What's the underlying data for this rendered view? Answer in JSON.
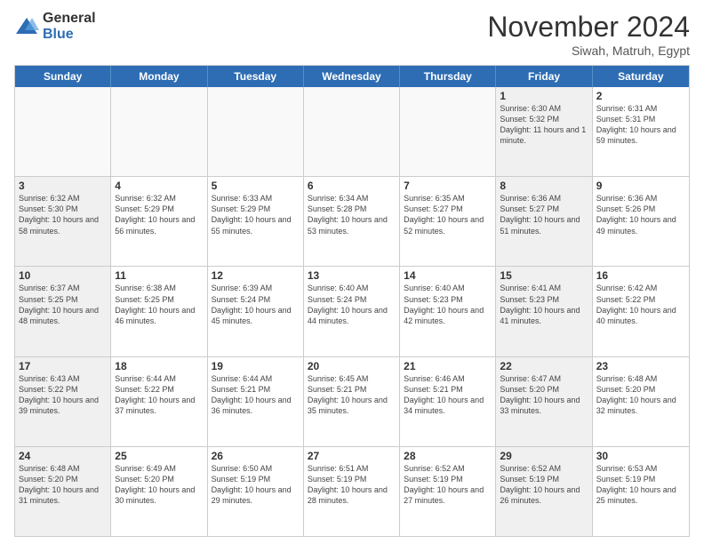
{
  "header": {
    "logo_general": "General",
    "logo_blue": "Blue",
    "month_title": "November 2024",
    "subtitle": "Siwah, Matruh, Egypt"
  },
  "days_of_week": [
    "Sunday",
    "Monday",
    "Tuesday",
    "Wednesday",
    "Thursday",
    "Friday",
    "Saturday"
  ],
  "weeks": [
    [
      {
        "day": "",
        "info": "",
        "empty": true
      },
      {
        "day": "",
        "info": "",
        "empty": true
      },
      {
        "day": "",
        "info": "",
        "empty": true
      },
      {
        "day": "",
        "info": "",
        "empty": true
      },
      {
        "day": "",
        "info": "",
        "empty": true
      },
      {
        "day": "1",
        "info": "Sunrise: 6:30 AM\nSunset: 5:32 PM\nDaylight: 11 hours\nand 1 minute.",
        "shaded": true
      },
      {
        "day": "2",
        "info": "Sunrise: 6:31 AM\nSunset: 5:31 PM\nDaylight: 10 hours\nand 59 minutes.",
        "shaded": false
      }
    ],
    [
      {
        "day": "3",
        "info": "Sunrise: 6:32 AM\nSunset: 5:30 PM\nDaylight: 10 hours\nand 58 minutes.",
        "shaded": true
      },
      {
        "day": "4",
        "info": "Sunrise: 6:32 AM\nSunset: 5:29 PM\nDaylight: 10 hours\nand 56 minutes.",
        "shaded": false
      },
      {
        "day": "5",
        "info": "Sunrise: 6:33 AM\nSunset: 5:29 PM\nDaylight: 10 hours\nand 55 minutes.",
        "shaded": false
      },
      {
        "day": "6",
        "info": "Sunrise: 6:34 AM\nSunset: 5:28 PM\nDaylight: 10 hours\nand 53 minutes.",
        "shaded": false
      },
      {
        "day": "7",
        "info": "Sunrise: 6:35 AM\nSunset: 5:27 PM\nDaylight: 10 hours\nand 52 minutes.",
        "shaded": false
      },
      {
        "day": "8",
        "info": "Sunrise: 6:36 AM\nSunset: 5:27 PM\nDaylight: 10 hours\nand 51 minutes.",
        "shaded": true
      },
      {
        "day": "9",
        "info": "Sunrise: 6:36 AM\nSunset: 5:26 PM\nDaylight: 10 hours\nand 49 minutes.",
        "shaded": false
      }
    ],
    [
      {
        "day": "10",
        "info": "Sunrise: 6:37 AM\nSunset: 5:25 PM\nDaylight: 10 hours\nand 48 minutes.",
        "shaded": true
      },
      {
        "day": "11",
        "info": "Sunrise: 6:38 AM\nSunset: 5:25 PM\nDaylight: 10 hours\nand 46 minutes.",
        "shaded": false
      },
      {
        "day": "12",
        "info": "Sunrise: 6:39 AM\nSunset: 5:24 PM\nDaylight: 10 hours\nand 45 minutes.",
        "shaded": false
      },
      {
        "day": "13",
        "info": "Sunrise: 6:40 AM\nSunset: 5:24 PM\nDaylight: 10 hours\nand 44 minutes.",
        "shaded": false
      },
      {
        "day": "14",
        "info": "Sunrise: 6:40 AM\nSunset: 5:23 PM\nDaylight: 10 hours\nand 42 minutes.",
        "shaded": false
      },
      {
        "day": "15",
        "info": "Sunrise: 6:41 AM\nSunset: 5:23 PM\nDaylight: 10 hours\nand 41 minutes.",
        "shaded": true
      },
      {
        "day": "16",
        "info": "Sunrise: 6:42 AM\nSunset: 5:22 PM\nDaylight: 10 hours\nand 40 minutes.",
        "shaded": false
      }
    ],
    [
      {
        "day": "17",
        "info": "Sunrise: 6:43 AM\nSunset: 5:22 PM\nDaylight: 10 hours\nand 39 minutes.",
        "shaded": true
      },
      {
        "day": "18",
        "info": "Sunrise: 6:44 AM\nSunset: 5:22 PM\nDaylight: 10 hours\nand 37 minutes.",
        "shaded": false
      },
      {
        "day": "19",
        "info": "Sunrise: 6:44 AM\nSunset: 5:21 PM\nDaylight: 10 hours\nand 36 minutes.",
        "shaded": false
      },
      {
        "day": "20",
        "info": "Sunrise: 6:45 AM\nSunset: 5:21 PM\nDaylight: 10 hours\nand 35 minutes.",
        "shaded": false
      },
      {
        "day": "21",
        "info": "Sunrise: 6:46 AM\nSunset: 5:21 PM\nDaylight: 10 hours\nand 34 minutes.",
        "shaded": false
      },
      {
        "day": "22",
        "info": "Sunrise: 6:47 AM\nSunset: 5:20 PM\nDaylight: 10 hours\nand 33 minutes.",
        "shaded": true
      },
      {
        "day": "23",
        "info": "Sunrise: 6:48 AM\nSunset: 5:20 PM\nDaylight: 10 hours\nand 32 minutes.",
        "shaded": false
      }
    ],
    [
      {
        "day": "24",
        "info": "Sunrise: 6:48 AM\nSunset: 5:20 PM\nDaylight: 10 hours\nand 31 minutes.",
        "shaded": true
      },
      {
        "day": "25",
        "info": "Sunrise: 6:49 AM\nSunset: 5:20 PM\nDaylight: 10 hours\nand 30 minutes.",
        "shaded": false
      },
      {
        "day": "26",
        "info": "Sunrise: 6:50 AM\nSunset: 5:19 PM\nDaylight: 10 hours\nand 29 minutes.",
        "shaded": false
      },
      {
        "day": "27",
        "info": "Sunrise: 6:51 AM\nSunset: 5:19 PM\nDaylight: 10 hours\nand 28 minutes.",
        "shaded": false
      },
      {
        "day": "28",
        "info": "Sunrise: 6:52 AM\nSunset: 5:19 PM\nDaylight: 10 hours\nand 27 minutes.",
        "shaded": false
      },
      {
        "day": "29",
        "info": "Sunrise: 6:52 AM\nSunset: 5:19 PM\nDaylight: 10 hours\nand 26 minutes.",
        "shaded": true
      },
      {
        "day": "30",
        "info": "Sunrise: 6:53 AM\nSunset: 5:19 PM\nDaylight: 10 hours\nand 25 minutes.",
        "shaded": false
      }
    ]
  ]
}
